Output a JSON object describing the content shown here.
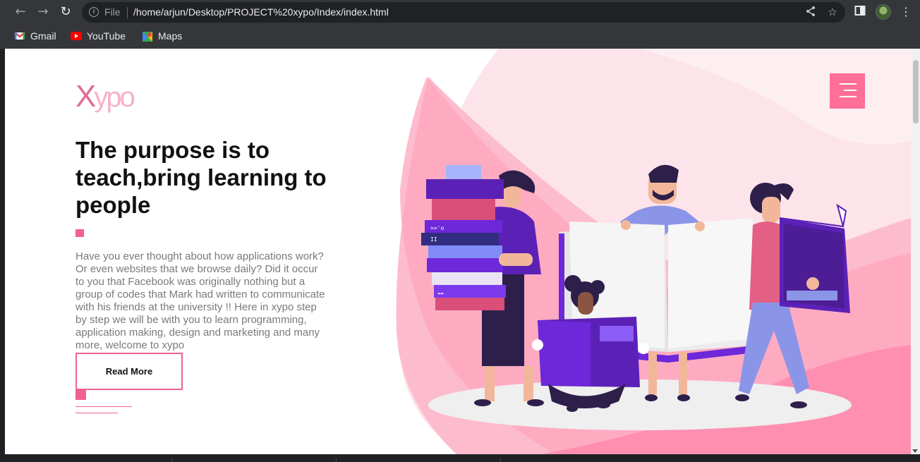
{
  "browser": {
    "url_scheme_label": "File",
    "url": "/home/arjun/Desktop/PROJECT%20xypo/Index/index.html",
    "bookmarks": [
      {
        "label": "Gmail",
        "icon": "gmail-icon"
      },
      {
        "label": "YouTube",
        "icon": "youtube-icon"
      },
      {
        "label": "Maps",
        "icon": "maps-icon"
      }
    ]
  },
  "page": {
    "logo": {
      "first": "X",
      "rest": "ypo"
    },
    "headline": "The purpose is to teach,bring learning to people",
    "body": "Have you ever thought about how applications work? Or even websites that we browse daily? Did it occur to you that Facebook was originally nothing but a group of codes that Mark had written to communicate with his friends at the university !! Here in xypo step by step we will be with you to learn programming, application making, design and marketing and many more, welcome to xypo",
    "cta_label": "Read More",
    "accent_color": "#f06292",
    "menu_button_color": "#ff6f98",
    "book_labels": [
      ">>'o",
      "II",
      "►►"
    ]
  }
}
